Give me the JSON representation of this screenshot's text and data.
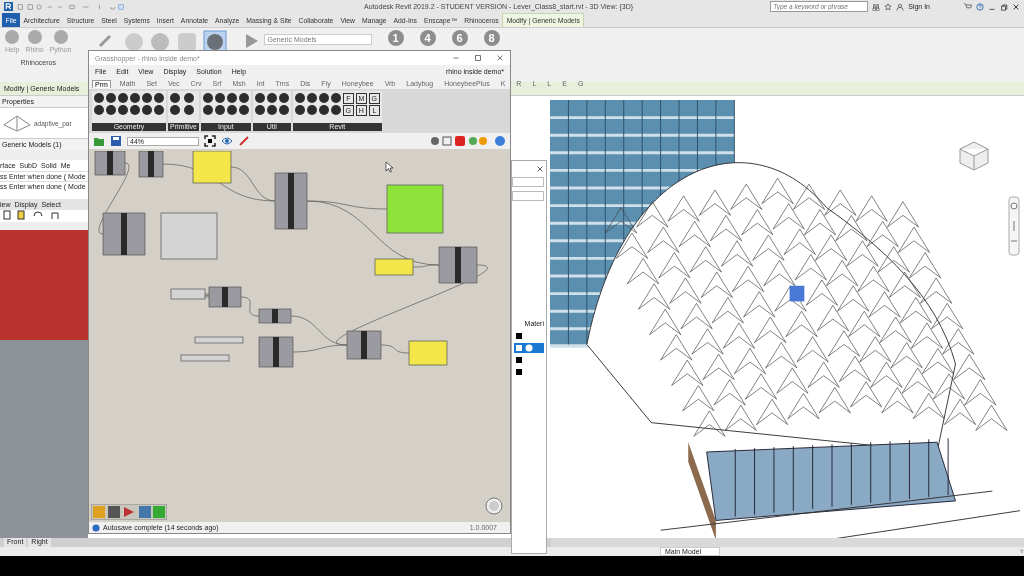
{
  "revit": {
    "title": "Autodesk Revit 2019.2 - STUDENT VERSION - Lever_Class8_start.rvt - 3D View: {3D}",
    "search": {
      "placeholder": "Type a keyword or phrase"
    },
    "sign_in": "Sign In",
    "tabs": [
      {
        "label": "File",
        "kind": "file",
        "selected": false
      },
      {
        "label": "Architecture",
        "kind": "tab",
        "selected": false
      },
      {
        "label": "Structure",
        "kind": "tab",
        "selected": false
      },
      {
        "label": "Steel",
        "kind": "tab",
        "selected": false
      },
      {
        "label": "Systems",
        "kind": "tab",
        "selected": false
      },
      {
        "label": "Insert",
        "kind": "tab",
        "selected": false
      },
      {
        "label": "Annotate",
        "kind": "tab",
        "selected": false
      },
      {
        "label": "Analyze",
        "kind": "tab",
        "selected": false
      },
      {
        "label": "Massing & Site",
        "kind": "tab",
        "selected": false
      },
      {
        "label": "Collaborate",
        "kind": "tab",
        "selected": false
      },
      {
        "label": "View",
        "kind": "tab",
        "selected": false
      },
      {
        "label": "Manage",
        "kind": "tab",
        "selected": false
      },
      {
        "label": "Add-Ins",
        "kind": "tab",
        "selected": false
      },
      {
        "label": "Enscape™",
        "kind": "tab",
        "selected": false
      },
      {
        "label": "Rhinoceros",
        "kind": "tab",
        "selected": false
      },
      {
        "label": "Modify | Generic Models",
        "kind": "tab",
        "selected": true
      }
    ],
    "ribbon": {
      "buttons": [
        "Help",
        "Rhino",
        "Python"
      ],
      "panel_label": "Rhinoceros",
      "category": "Generic Models",
      "numbers": [
        "1",
        "4",
        "6",
        "8"
      ]
    },
    "context_bar": "Modify | Generic Models",
    "properties": {
      "title": "Properties",
      "type_name": "adaptive_par",
      "selection": "Generic Models (1)"
    },
    "rhino_panel": {
      "tabs": [
        "rface",
        "SubD",
        "Solid",
        "Me"
      ],
      "command_lines": [
        "ss Enter when done ( Mode",
        "ss Enter when done ( Mode"
      ],
      "view_tabs": [
        "iew",
        "Display",
        "Select"
      ]
    },
    "side_panel": {
      "column": "Materi"
    },
    "view_tabs": [
      "Front",
      "Right"
    ],
    "status_bar": {
      "model": "Main Model"
    }
  },
  "grasshopper": {
    "title": "Grasshopper - rhino inside demo*",
    "menu": [
      "File",
      "Edit",
      "View",
      "Display",
      "Solution",
      "Help"
    ],
    "document": "rhino inside demo*",
    "tabs": [
      {
        "label": "Prm",
        "selected": true
      },
      {
        "label": "Math",
        "selected": false
      },
      {
        "label": "Set",
        "selected": false
      },
      {
        "label": "Vec",
        "selected": false
      },
      {
        "label": "Crv",
        "selected": false
      },
      {
        "label": "Srf",
        "selected": false
      },
      {
        "label": "Msh",
        "selected": false
      },
      {
        "label": "Int",
        "selected": false
      },
      {
        "label": "Trns",
        "selected": false
      },
      {
        "label": "Dis",
        "selected": false
      },
      {
        "label": "Fly",
        "selected": false
      },
      {
        "label": "Honeybee",
        "selected": false
      },
      {
        "label": "Vrb",
        "selected": false
      },
      {
        "label": "Ladybug",
        "selected": false
      },
      {
        "label": "HoneybeePlus",
        "selected": false
      },
      {
        "label": "K",
        "selected": false
      },
      {
        "label": "R",
        "selected": false
      },
      {
        "label": "L",
        "selected": false
      },
      {
        "label": "L",
        "selected": false
      },
      {
        "label": "E",
        "selected": false
      },
      {
        "label": "G",
        "selected": false
      }
    ],
    "groups": [
      {
        "label": "Geometry"
      },
      {
        "label": "Primitive"
      },
      {
        "label": "Input"
      },
      {
        "label": "Util"
      },
      {
        "label": "Revit",
        "keys": [
          "F",
          "G",
          "M",
          "H",
          "G",
          "L"
        ]
      }
    ],
    "zoom": "44%",
    "status": "Autosave complete (14 seconds ago)",
    "version": "1.0.0007"
  }
}
